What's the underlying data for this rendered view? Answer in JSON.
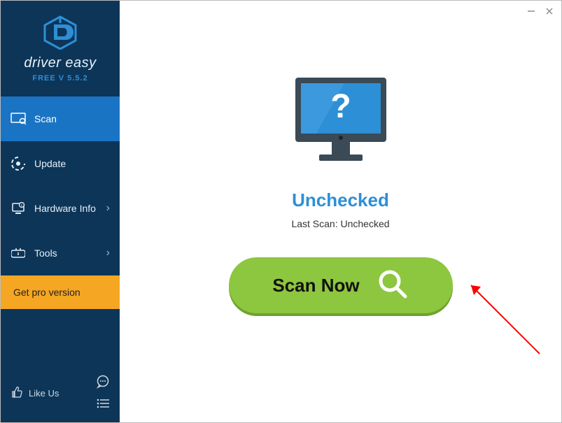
{
  "brand": {
    "name": "driver easy",
    "version": "FREE V 5.5.2"
  },
  "sidebar": {
    "items": [
      {
        "label": "Scan",
        "active": true,
        "has_chevron": false
      },
      {
        "label": "Update",
        "active": false,
        "has_chevron": false
      },
      {
        "label": "Hardware Info",
        "active": false,
        "has_chevron": true
      },
      {
        "label": "Tools",
        "active": false,
        "has_chevron": true
      }
    ],
    "get_pro_label": "Get pro version",
    "like_us_label": "Like Us"
  },
  "main": {
    "status_title": "Unchecked",
    "status_subtitle": "Last Scan: Unchecked",
    "scan_button_label": "Scan Now"
  },
  "colors": {
    "sidebar_bg": "#0d3558",
    "accent": "#1a74c4",
    "green": "#8dc63f",
    "orange": "#f5a623",
    "link_blue": "#2d8fd6"
  }
}
